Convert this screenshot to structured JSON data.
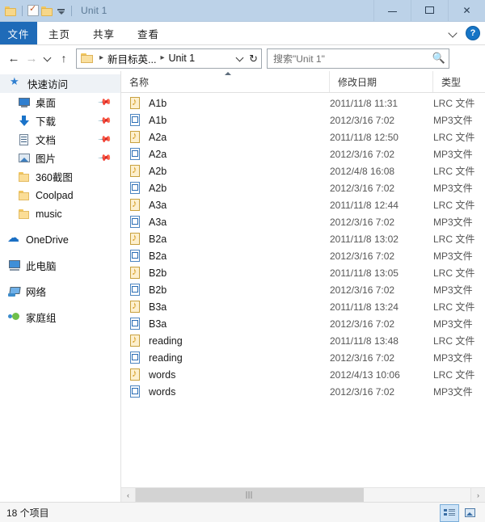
{
  "window": {
    "title": "Unit 1",
    "quick_access_icons": [
      "folder-icon",
      "properties-icon",
      "new-folder-icon",
      "customize-caret-icon"
    ],
    "controls": {
      "minimize": "−",
      "maximize": "▢",
      "close": "✕"
    }
  },
  "ribbon": {
    "file_tab": "文件",
    "tabs": [
      "主页",
      "共享",
      "查看"
    ],
    "expand_icon": "chevron-down-icon",
    "help_label": "?"
  },
  "navbar": {
    "back_icon": "←",
    "forward_icon": "→",
    "recent_icon": "chevron-down-icon",
    "up_icon": "↑",
    "breadcrumbs": [
      "新目标英...",
      "Unit 1"
    ],
    "dropdown_icon": "chevron-down-icon",
    "refresh_icon": "↻"
  },
  "search": {
    "placeholder": "搜索\"Unit 1\"",
    "icon": "search-icon"
  },
  "sidebar": {
    "items": [
      {
        "label": "快速访问",
        "icon": "star-icon",
        "kind": "header",
        "pinned": false
      },
      {
        "label": "桌面",
        "icon": "desktop-icon",
        "kind": "child",
        "pinned": true
      },
      {
        "label": "下载",
        "icon": "download-icon",
        "kind": "child",
        "pinned": true
      },
      {
        "label": "文档",
        "icon": "documents-icon",
        "kind": "child",
        "pinned": true
      },
      {
        "label": "图片",
        "icon": "pictures-icon",
        "kind": "child",
        "pinned": true
      },
      {
        "label": "360截图",
        "icon": "folder-icon",
        "kind": "child",
        "pinned": false
      },
      {
        "label": "Coolpad",
        "icon": "folder-icon",
        "kind": "child",
        "pinned": false
      },
      {
        "label": "music",
        "icon": "folder-icon",
        "kind": "child",
        "pinned": false
      },
      {
        "label": "OneDrive",
        "icon": "cloud-icon",
        "kind": "group",
        "pinned": false
      },
      {
        "label": "此电脑",
        "icon": "computer-icon",
        "kind": "group",
        "pinned": false
      },
      {
        "label": "网络",
        "icon": "network-icon",
        "kind": "group",
        "pinned": false
      },
      {
        "label": "家庭组",
        "icon": "homegroup-icon",
        "kind": "group",
        "pinned": false
      }
    ]
  },
  "filelist": {
    "columns": [
      "名称",
      "修改日期",
      "类型"
    ],
    "sort_column": "名称",
    "sort_direction": "asc",
    "rows": [
      {
        "name": "A1b",
        "date": "2011/11/8 11:31",
        "type": "LRC 文件",
        "icon": "lrc-file-icon"
      },
      {
        "name": "A1b",
        "date": "2012/3/16 7:02",
        "type": "MP3文件",
        "icon": "mp3-file-icon"
      },
      {
        "name": "A2a",
        "date": "2011/11/8 12:50",
        "type": "LRC 文件",
        "icon": "lrc-file-icon"
      },
      {
        "name": "A2a",
        "date": "2012/3/16 7:02",
        "type": "MP3文件",
        "icon": "mp3-file-icon"
      },
      {
        "name": "A2b",
        "date": "2012/4/8 16:08",
        "type": "LRC 文件",
        "icon": "lrc-file-icon"
      },
      {
        "name": "A2b",
        "date": "2012/3/16 7:02",
        "type": "MP3文件",
        "icon": "mp3-file-icon"
      },
      {
        "name": "A3a",
        "date": "2011/11/8 12:44",
        "type": "LRC 文件",
        "icon": "lrc-file-icon"
      },
      {
        "name": "A3a",
        "date": "2012/3/16 7:02",
        "type": "MP3文件",
        "icon": "mp3-file-icon"
      },
      {
        "name": "B2a",
        "date": "2011/11/8 13:02",
        "type": "LRC 文件",
        "icon": "lrc-file-icon"
      },
      {
        "name": "B2a",
        "date": "2012/3/16 7:02",
        "type": "MP3文件",
        "icon": "mp3-file-icon"
      },
      {
        "name": "B2b",
        "date": "2011/11/8 13:05",
        "type": "LRC 文件",
        "icon": "lrc-file-icon"
      },
      {
        "name": "B2b",
        "date": "2012/3/16 7:02",
        "type": "MP3文件",
        "icon": "mp3-file-icon"
      },
      {
        "name": "B3a",
        "date": "2011/11/8 13:24",
        "type": "LRC 文件",
        "icon": "lrc-file-icon"
      },
      {
        "name": "B3a",
        "date": "2012/3/16 7:02",
        "type": "MP3文件",
        "icon": "mp3-file-icon"
      },
      {
        "name": "reading",
        "date": "2011/11/8 13:48",
        "type": "LRC 文件",
        "icon": "lrc-file-icon"
      },
      {
        "name": "reading",
        "date": "2012/3/16 7:02",
        "type": "MP3文件",
        "icon": "mp3-file-icon"
      },
      {
        "name": "words",
        "date": "2012/4/13 10:06",
        "type": "LRC 文件",
        "icon": "lrc-file-icon"
      },
      {
        "name": "words",
        "date": "2012/3/16 7:02",
        "type": "MP3文件",
        "icon": "mp3-file-icon"
      }
    ]
  },
  "scrollbar": {
    "left_icon": "‹",
    "right_icon": "›",
    "grip_icon": "grip-icon"
  },
  "statusbar": {
    "item_count": "18 个项目",
    "view_details_icon": "details-view-icon",
    "view_icons_icon": "large-icons-view-icon"
  },
  "colors": {
    "titlebar": "#bcd2e8",
    "file_tab": "#1f6bb8",
    "accent": "#1675c6"
  }
}
